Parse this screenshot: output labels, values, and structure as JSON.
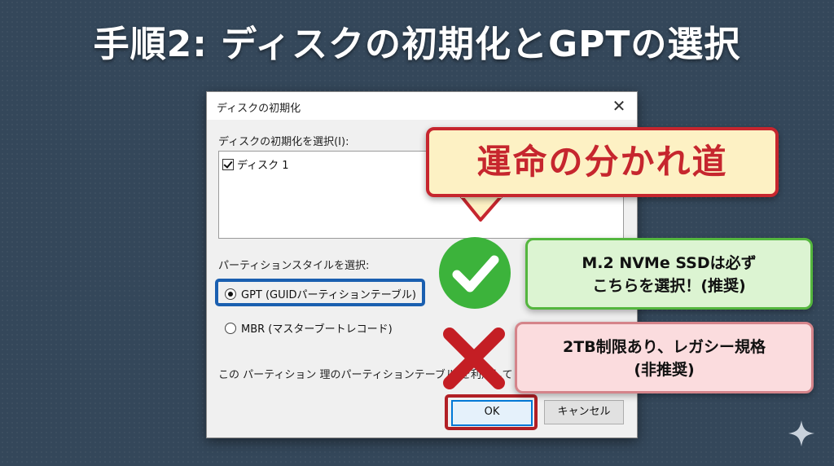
{
  "slide": {
    "title": "手順2: ディスクの初期化とGPTの選択"
  },
  "dialog": {
    "title": "ディスクの初期化",
    "select_disk_label": "ディスクの初期化を選択(I):",
    "disks": [
      {
        "label": "ディスク 1",
        "checked": true
      }
    ],
    "partition_style_label": "パーティションスタイルを選択:",
    "options": [
      {
        "label": "GPT (GUIDパーティションテーブル)",
        "selected": true
      },
      {
        "label": "MBR (マスターブートレコード)",
        "selected": false
      }
    ],
    "note": "この パーティション 理のパーティションテーブル)を利用して ください",
    "ok_label": "OK",
    "cancel_label": "キャンセル"
  },
  "annotations": {
    "bubble": "運命の分かれ道",
    "gpt_callout": {
      "line1": "M.2 NVMe SSDは必ず",
      "line2": "こちらを選択！(推奨)"
    },
    "mbr_callout": {
      "line1": "2TB制限あり、レガシー規格",
      "line2": "(非推奨)"
    }
  },
  "colors": {
    "background": "#34475a",
    "highlight_blue": "#1a5fb0",
    "highlight_red": "#c6262e",
    "check_green": "#3cb33b",
    "cross_red": "#c41e24"
  },
  "icons": [
    "close-icon",
    "checkmark-icon",
    "cross-icon",
    "sparkle-icon"
  ]
}
